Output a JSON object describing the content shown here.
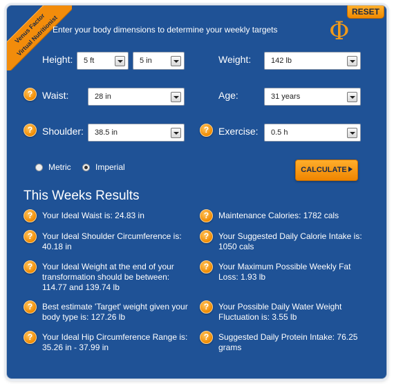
{
  "brand": {
    "ribbon_line1": "Venus Factor",
    "ribbon_line2": "Virtual Nutritionist",
    "logo_glyph": "Φ"
  },
  "header": {
    "reset_label": "RESET",
    "intro": "Enter your body dimensions to determine your weekly targets"
  },
  "form": {
    "height_label": "Height:",
    "height_ft": "5 ft",
    "height_in": "5 in",
    "weight_label": "Weight:",
    "weight_value": "142 lb",
    "waist_label": "Waist:",
    "waist_value": "28 in",
    "age_label": "Age:",
    "age_value": "31 years",
    "shoulder_label": "Shoulder:",
    "shoulder_value": "38.5 in",
    "exercise_label": "Exercise:",
    "exercise_value": "0.5 h",
    "help_glyph": "?",
    "units": {
      "metric": "Metric",
      "imperial": "Imperial",
      "selected": "Imperial"
    },
    "calculate_label": "CALCULATE"
  },
  "results": {
    "title": "This Weeks Results",
    "left": [
      [
        "Your Ideal Waist is: 24.83 in"
      ],
      [
        "Your Ideal Shoulder Circumference is:",
        "40.18 in"
      ],
      [
        "Your Ideal Weight at the end of your",
        "transformation should be between:",
        "114.77 and 139.74 lb"
      ],
      [
        "Best estimate 'Target' weight given your",
        "body type is: 127.26 lb"
      ],
      [
        "Your Ideal Hip Circumference Range is:",
        "35.26 in - 37.99 in"
      ]
    ],
    "right": [
      [
        "Maintenance Calories: 1782 cals"
      ],
      [
        "Your Suggested Daily Calorie Intake is:",
        "1050 cals"
      ],
      [
        "Your Maximum Possible Weekly Fat",
        "Loss: 1.93 lb"
      ],
      [
        "Your Possible Daily Water Weight",
        "Fluctuation is: 3.55 lb"
      ],
      [
        "Suggested Daily Protein Intake: 76.25",
        "grams"
      ]
    ]
  }
}
